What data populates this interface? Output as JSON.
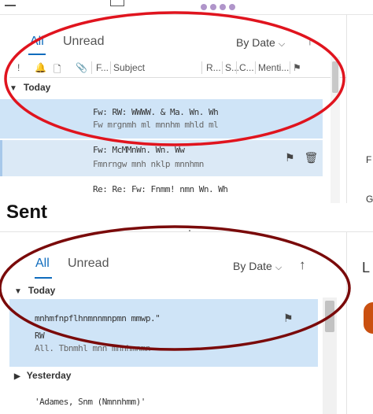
{
  "inbox_panel": {
    "tabs": [
      {
        "label": "All",
        "active": true
      },
      {
        "label": "Unread",
        "active": false
      }
    ],
    "sort_label": "By Date",
    "sort_direction_icon": "arrow-up-icon",
    "columns": [
      "F...",
      "Subject",
      "R...",
      "S...",
      "C...",
      "Menti..."
    ],
    "group_today": "Today",
    "rows": [
      {
        "line1": "Fw: RW: WWWW. & Ma. Wn. Wh",
        "line2": "Fw mrgnmh ml mnnhm mhld ml"
      },
      {
        "line1": "Fw: McMMnWn.              Wn. Ww",
        "line2": "Fmnrngw mnh nklp mnnhmn"
      },
      {
        "line1": "Re: Re: Fw: Fnmm! nmn Wn. Wh"
      }
    ]
  },
  "sent_label": "Sent",
  "sent_panel": {
    "tabs": [
      {
        "label": "All",
        "active": true
      },
      {
        "label": "Unread",
        "active": false
      }
    ],
    "sort_label": "By Date",
    "sort_direction_icon": "arrow-up-icon",
    "group_today": "Today",
    "rows": [
      {
        "line1": "mnhmfnpflhnmnnmnpmn mmwp.\"",
        "line2": "RW",
        "line3": "All. Tbnmhl mnn mnnhmnmn"
      }
    ],
    "group_yesterday": "Yesterday",
    "rows_yesterday": [
      {
        "line1": "'Adames, Snm (Nmnnhmm)'"
      }
    ]
  },
  "right_panel": {
    "letter_top_1": "F",
    "letter_top_2": "G",
    "letter_bottom": "L"
  },
  "colors": {
    "accent": "#0f6cbd",
    "selection": "#cfe4f7",
    "annotation_red": "#e0141e",
    "annotation_dark_red": "#7a0a0a"
  }
}
